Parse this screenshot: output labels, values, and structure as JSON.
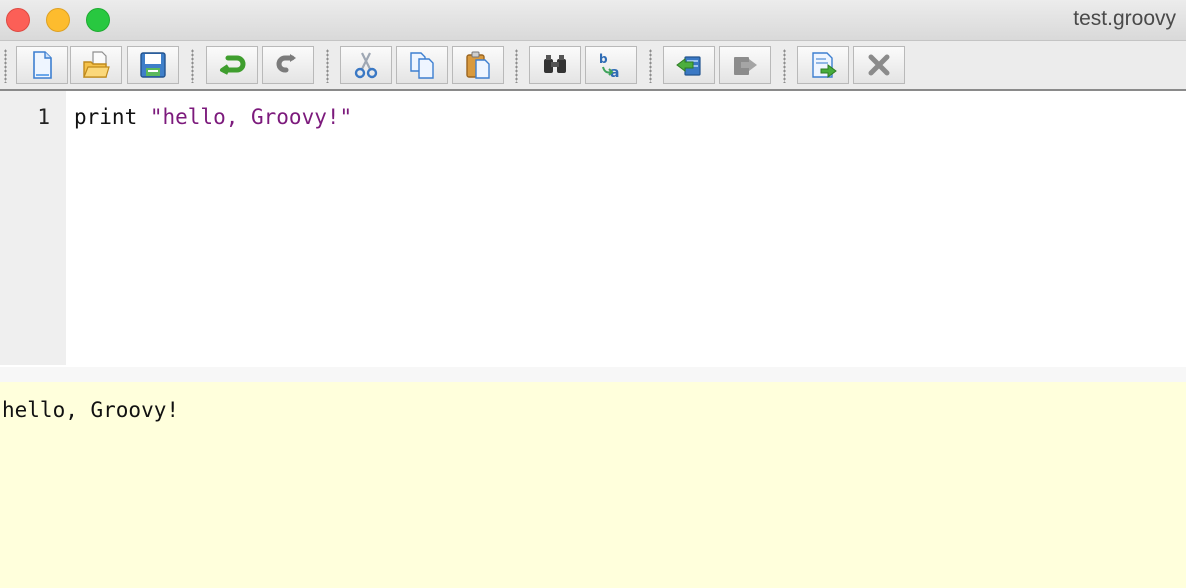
{
  "window": {
    "title": "test.groovy"
  },
  "toolbar": {
    "groups": [
      [
        "new-file-icon",
        "open-file-icon",
        "save-icon"
      ],
      [
        "undo-icon",
        "redo-icon"
      ],
      [
        "cut-icon",
        "copy-icon",
        "paste-icon"
      ],
      [
        "find-icon",
        "replace-icon"
      ],
      [
        "history-previous-icon",
        "history-next-icon"
      ],
      [
        "run-script-icon",
        "interrupt-icon"
      ]
    ],
    "disabled": [
      "redo-icon",
      "history-next-icon",
      "interrupt-icon"
    ]
  },
  "editor": {
    "lines": [
      {
        "number": "1",
        "code_prefix": "print ",
        "code_string": "\"hello, Groovy!\""
      }
    ]
  },
  "output": {
    "text": "hello, Groovy!"
  },
  "colors": {
    "editor_string": "#7c1a7c",
    "output_background": "#ffffdc",
    "gutter_background": "#efefef"
  }
}
